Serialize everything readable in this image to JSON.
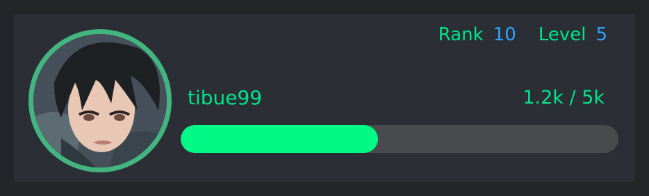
{
  "card": {
    "username": "tibue99",
    "rank_label": "Rank",
    "rank_value": "10",
    "level_label": "Level",
    "level_value": "5",
    "xp_text": "1.2k / 5k",
    "progress_fraction": 0.45
  },
  "colors": {
    "background": "#232629",
    "card": "#2b2f35",
    "accent_green": "#00e38a",
    "bar_fill": "#00fa85",
    "bar_track": "#484b4e",
    "value_blue": "#2ea3ff",
    "avatar_ring": "#43b581"
  },
  "icons": {
    "avatar": "user-avatar-image"
  }
}
